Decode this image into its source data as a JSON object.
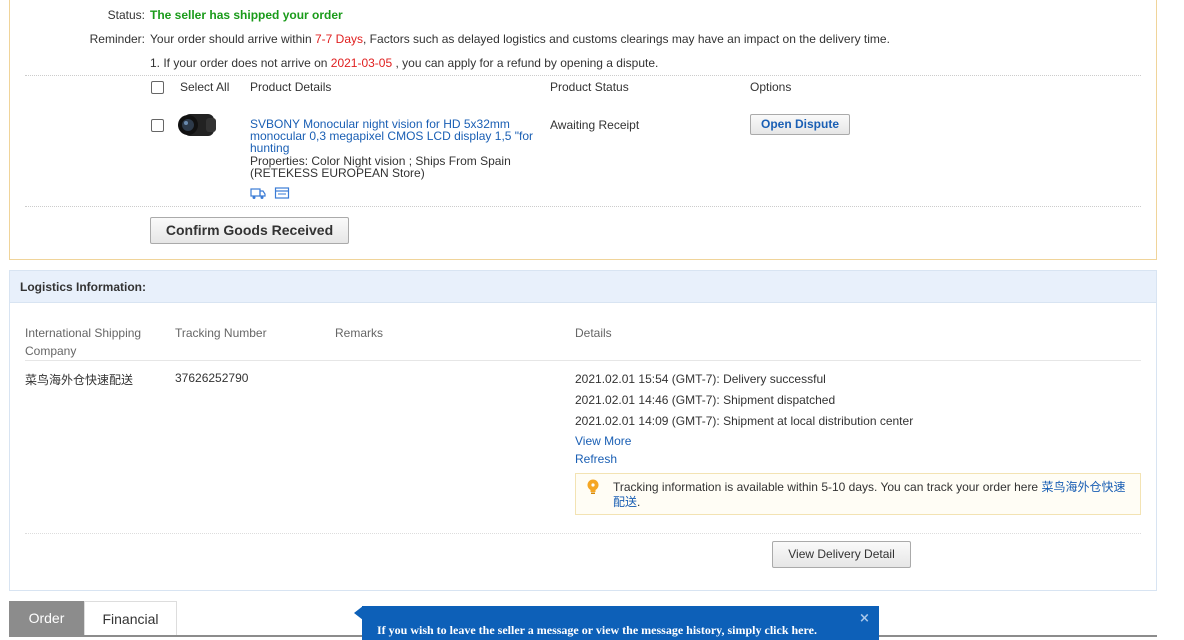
{
  "order": {
    "status_label": "Status:",
    "status_value": "The seller has shipped your order",
    "reminder_label": "Reminder:",
    "reminder_pre": "Your order should arrive within ",
    "reminder_days": "7-7 Days",
    "reminder_post": ", Factors such as delayed logistics and customs clearings may have an impact on the delivery time.",
    "refund_pre": "1. If your order does not arrive on ",
    "refund_date": "2021-03-05",
    "refund_post": " , you can apply for a refund by opening a dispute.",
    "headers": {
      "select_all": "Select All",
      "product_details": "Product Details",
      "product_status": "Product Status",
      "options": "Options"
    },
    "product": {
      "title": "SVBONY Monocular night vision for HD 5x32mm monocular 0,3 megapixel CMOS LCD display 1,5 \"for hunting",
      "properties": "Properties: Color Night vision   ; Ships From Spain",
      "store": "(RETEKESS EUROPEAN Store)",
      "status": "Awaiting Receipt",
      "option_button": "Open Dispute"
    },
    "confirm_button": "Confirm Goods Received"
  },
  "logistics": {
    "title": "Logistics Information:",
    "headers": {
      "company_line1": "International Shipping",
      "company_line2": "Company",
      "tracking": "Tracking Number",
      "remarks": "Remarks",
      "details": "Details"
    },
    "row": {
      "company": "菜鸟海外仓快速配送",
      "tracking_number": "37626252790",
      "remarks": ""
    },
    "events": [
      "2021.02.01 15:54 (GMT-7): Delivery successful",
      "2021.02.01 14:46 (GMT-7): Shipment dispatched",
      "2021.02.01 14:09 (GMT-7): Shipment at local distribution center"
    ],
    "view_more": "View More",
    "refresh": "Refresh",
    "tip_pre": "Tracking information is available within 5-10 days. You can track your order here ",
    "tip_link_line1": "菜鸟海外仓快速",
    "tip_link_line2": "配送",
    "tip_post": ".",
    "view_delivery_button": "View Delivery Detail"
  },
  "tabs": [
    {
      "label": "Order",
      "active": true
    },
    {
      "label": "Financial",
      "active": false
    }
  ],
  "message_popup": {
    "text": "If you wish to leave the seller a message or view the message history, simply click here.",
    "close": "×"
  },
  "colors": {
    "status_green": "#1a9b1a",
    "highlight_red": "#e02020",
    "link_blue": "#1a5fb4",
    "popup_blue": "#0d60b8",
    "tip_icon": "#f5a623"
  }
}
